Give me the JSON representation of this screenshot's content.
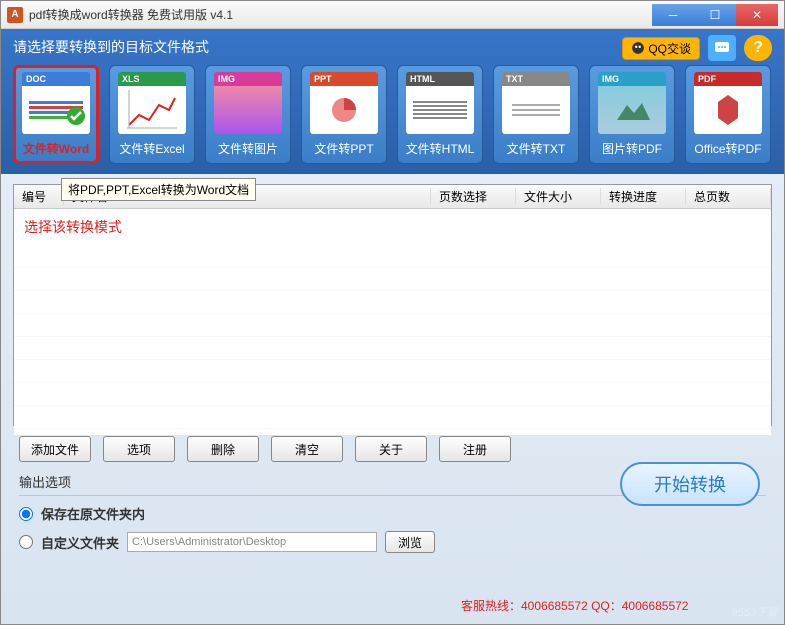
{
  "window": {
    "title": "pdf转换成word转换器 免费试用版 v4.1"
  },
  "header": {
    "title": "请选择要转换到的目标文件格式",
    "qq_btn": "QQ交谈",
    "help": "?"
  },
  "formats": [
    {
      "tag": "DOC",
      "tag_color": "#3b7dd8",
      "label": "文件转Word"
    },
    {
      "tag": "XLS",
      "tag_color": "#2a9a4a",
      "label": "文件转Excel"
    },
    {
      "tag": "IMG",
      "tag_color": "#d83b9a",
      "label": "文件转图片"
    },
    {
      "tag": "PPT",
      "tag_color": "#d84a2a",
      "label": "文件转PPT"
    },
    {
      "tag": "HTML",
      "tag_color": "#555",
      "label": "文件转HTML"
    },
    {
      "tag": "TXT",
      "tag_color": "#888",
      "label": "文件转TXT"
    },
    {
      "tag": "IMG",
      "tag_color": "#2aa0c8",
      "label": "图片转PDF"
    },
    {
      "tag": "PDF",
      "tag_color": "#c82a2a",
      "label": "Office转PDF"
    }
  ],
  "tooltip": "将PDF,PPT,Excel转换为Word文档",
  "table": {
    "headers": {
      "num": "编号",
      "name": "文件名",
      "pages": "页数选择",
      "size": "文件大小",
      "prog": "转换进度",
      "total": "总页数"
    }
  },
  "annotation": "选择该转换模式",
  "buttons": {
    "add": "添加文件",
    "opts": "选项",
    "del": "删除",
    "clear": "清空",
    "about": "关于",
    "reg": "注册"
  },
  "output": {
    "title": "输出选项",
    "save_src": "保存在原文件夹内",
    "custom": "自定义文件夹",
    "path": "C:\\Users\\Administrator\\Desktop",
    "browse": "浏览",
    "start": "开始转换"
  },
  "hotline": "客服热线：4006685572 QQ：4006685572",
  "watermark": "9553下载"
}
